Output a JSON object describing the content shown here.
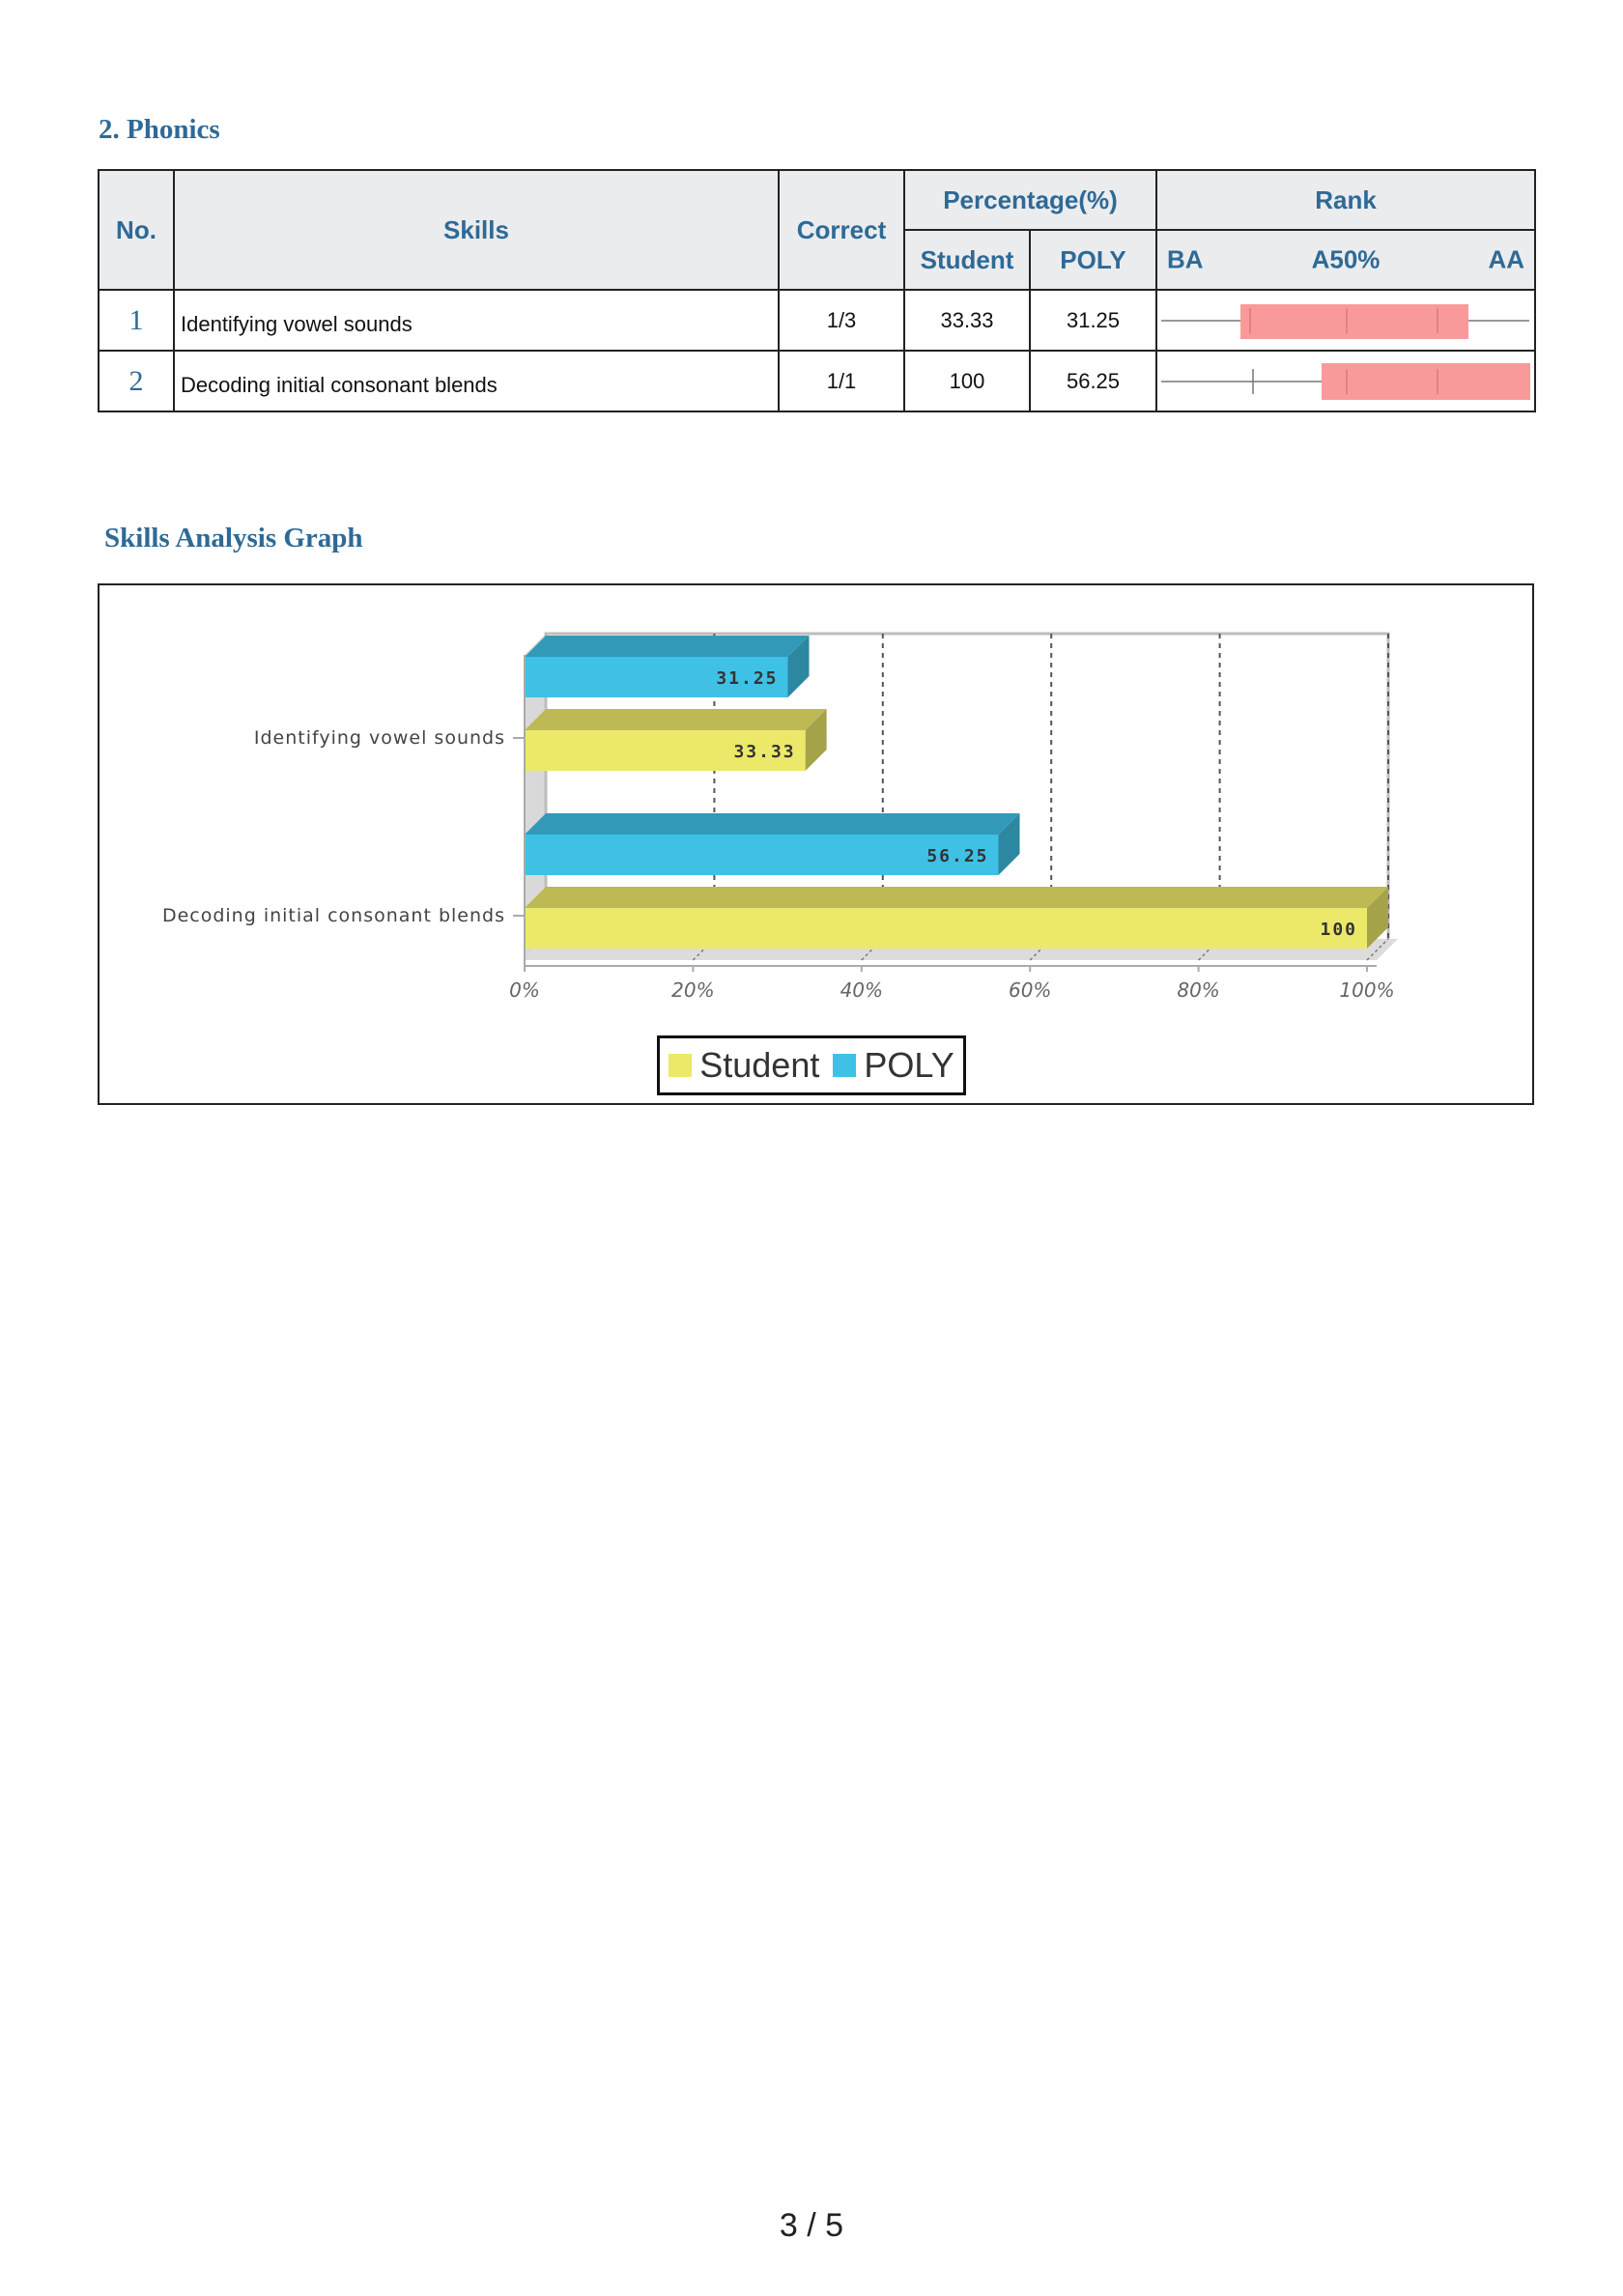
{
  "sections": {
    "phonics_title": "2. Phonics",
    "graph_title": "Skills Analysis Graph"
  },
  "table": {
    "headers": {
      "no": "No.",
      "skills": "Skills",
      "correct": "Correct",
      "percentage": "Percentage(%)",
      "rank": "Rank",
      "student": "Student",
      "poly": "POLY",
      "ba": "BA",
      "a50": "A50%",
      "aa": "AA"
    },
    "rows": [
      {
        "no": "1",
        "skill": "Identifying vowel sounds",
        "correct": "1/3",
        "student": "33.33",
        "poly": "31.25"
      },
      {
        "no": "2",
        "skill": "Decoding initial consonant blends",
        "correct": "1/1",
        "student": "100",
        "poly": "56.25"
      }
    ]
  },
  "chart_data": {
    "type": "bar",
    "orientation": "horizontal",
    "categories": [
      "Identifying vowel sounds",
      "Decoding initial consonant blends"
    ],
    "series": [
      {
        "name": "Student",
        "values": [
          33.33,
          100
        ],
        "color": "#ece96a"
      },
      {
        "name": "POLY",
        "values": [
          31.25,
          56.25
        ],
        "color": "#3fc1e6"
      }
    ],
    "x_ticks": [
      "0%",
      "20%",
      "40%",
      "60%",
      "80%",
      "100%"
    ],
    "xlim": [
      0,
      100
    ],
    "grid": true,
    "legend_position": "bottom"
  },
  "colors": {
    "accent": "#2e6a96",
    "rank_bar": "#f99a9a"
  },
  "page_number": "3 / 5"
}
